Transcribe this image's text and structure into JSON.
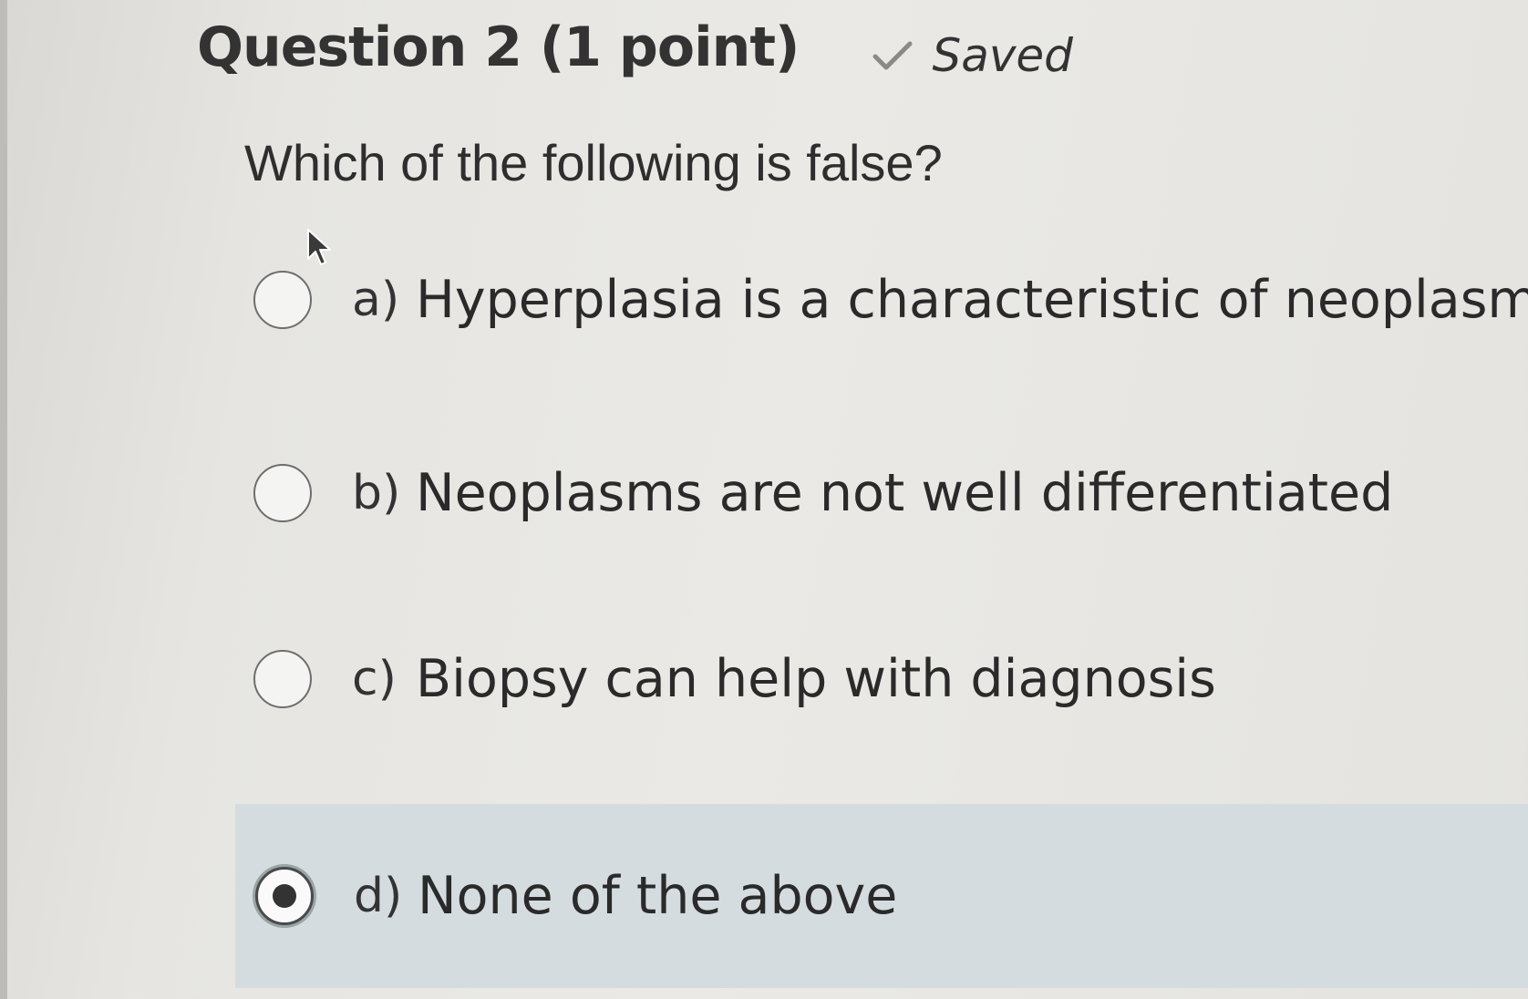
{
  "question": {
    "title": "Question 2 (1 point)",
    "status": "Saved",
    "prompt": "Which of the following is false?"
  },
  "options": [
    {
      "letter": "a)",
      "text": "Hyperplasia is a characteristic of neoplasms",
      "selected": false
    },
    {
      "letter": "b)",
      "text": "Neoplasms are not well differentiated",
      "selected": false
    },
    {
      "letter": "c)",
      "text": "Biopsy can help with diagnosis",
      "selected": false
    },
    {
      "letter": "d)",
      "text": "None of the above",
      "selected": true
    }
  ],
  "icons": {
    "status": "checkmark-icon",
    "pointer": "mouse-cursor-icon"
  },
  "colors": {
    "selected_row_bg": "#d5dcdf",
    "text": "#2c2c2c"
  }
}
